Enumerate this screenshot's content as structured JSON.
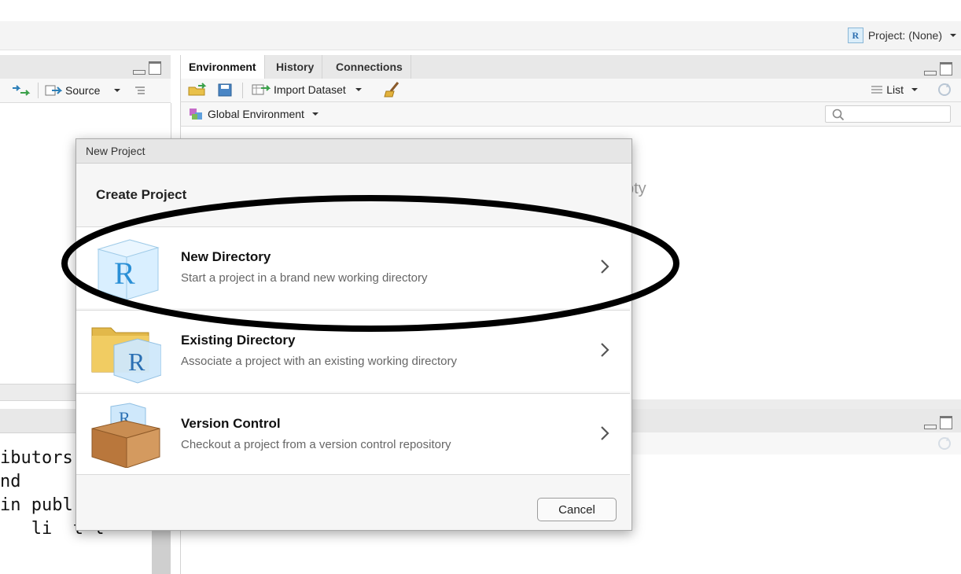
{
  "project_menu": {
    "label": "Project: (None)"
  },
  "source_pane": {
    "source_button": "Source",
    "console_lines": [
      "ibutors",
      "nd",
      "in publ",
      "",
      "   li  t l"
    ]
  },
  "env_pane": {
    "tabs": [
      "Environment",
      "History",
      "Connections"
    ],
    "import_dataset": "Import Dataset",
    "view_mode": "List",
    "scope": "Global Environment",
    "search_placeholder": "",
    "empty_text": "pty"
  },
  "dialog": {
    "window_title": "New Project",
    "heading": "Create Project",
    "options": [
      {
        "title": "New Directory",
        "description": "Start a project in a brand new working directory",
        "icon": "r-cube-icon"
      },
      {
        "title": "Existing Directory",
        "description": "Associate a project with an existing working directory",
        "icon": "folder-r-icon"
      },
      {
        "title": "Version Control",
        "description": "Checkout a project from a version control repository",
        "icon": "box-r-icon"
      }
    ],
    "cancel_label": "Cancel"
  },
  "annotation": {
    "type": "ellipse",
    "color": "#000000",
    "target": "New Directory"
  }
}
